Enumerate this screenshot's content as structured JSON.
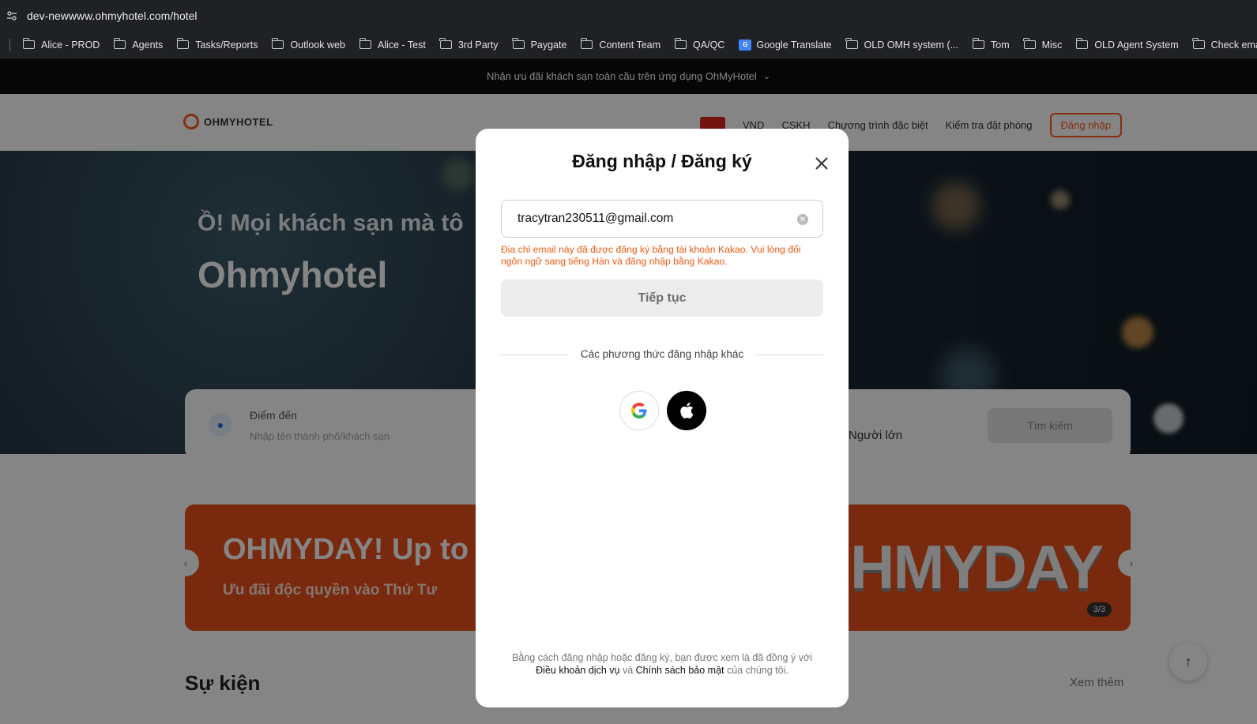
{
  "browser": {
    "url": "dev-newwww.ohmyhotel.com/hotel",
    "bookmarks": [
      {
        "label": "Alice - PROD",
        "icon": "folder-icon"
      },
      {
        "label": "Agents",
        "icon": "folder-icon"
      },
      {
        "label": "Tasks/Reports",
        "icon": "folder-icon"
      },
      {
        "label": "Outlook web",
        "icon": "folder-icon"
      },
      {
        "label": "Alice - Test",
        "icon": "folder-icon"
      },
      {
        "label": "3rd Party",
        "icon": "folder-icon"
      },
      {
        "label": "Paygate",
        "icon": "folder-icon"
      },
      {
        "label": "Content Team",
        "icon": "folder-icon"
      },
      {
        "label": "QA/QC",
        "icon": "folder-icon"
      },
      {
        "label": "Google Translate",
        "icon": "google-translate-icon"
      },
      {
        "label": "OLD OMH system (...",
        "icon": "folder-icon"
      },
      {
        "label": "Tom",
        "icon": "folder-icon"
      },
      {
        "label": "Misc",
        "icon": "folder-icon"
      },
      {
        "label": "OLD Agent System",
        "icon": "folder-icon"
      },
      {
        "label": "Check email sendi",
        "icon": "folder-icon"
      }
    ]
  },
  "site": {
    "promo_text": "Nhận ưu đãi khách sạn toàn cầu trên ứng dụng OhMyHotel",
    "logo_text": "OHMYHOTEL",
    "nav": {
      "currency": "VND",
      "cs": "CSKH",
      "special": "Chương trình đặc biệt",
      "check_booking": "Kiểm tra đặt phòng",
      "login": "Đăng nhập"
    },
    "hero": {
      "line1": "Ồ! Mọi khách sạn mà tô",
      "line2": "Ohmyhotel"
    },
    "search": {
      "destination_label": "Điểm đến",
      "destination_placeholder": "Nhập tên thành phố/khách sạn",
      "guests": "Người lớn",
      "search_btn": "Tìm kiếm"
    },
    "banner": {
      "title": "OHMYDAY! Up to",
      "subtitle": "Ưu đãi độc quyền vào Thứ Tư",
      "big": "HMYDAY",
      "page": "3/3"
    },
    "events_title": "Sự kiện",
    "see_more": "Xem thêm"
  },
  "modal": {
    "title": "Đăng nhập / Đăng ký",
    "email_value": "tracytran230511@gmail.com",
    "error": "Địa chỉ email này đã được đăng ký bằng tài khoản Kakao. Vui lòng đổi ngôn ngữ sang tiếng Hàn và đăng nhập bằng Kakao.",
    "continue_label": "Tiếp tục",
    "other_methods": "Các phương thức đăng nhập khác",
    "terms_prefix": "Bằng cách đăng nhập hoặc đăng ký, bạn được xem là đã đồng ý với",
    "terms_link": "Điều khoản dịch vụ",
    "terms_and": "và",
    "privacy_link": "Chính sách bảo mật",
    "terms_suffix": "của chúng tôi."
  },
  "colors": {
    "brand_orange": "#ff5a1f",
    "error_orange": "#ee5a12",
    "chrome_dark": "#202124"
  }
}
